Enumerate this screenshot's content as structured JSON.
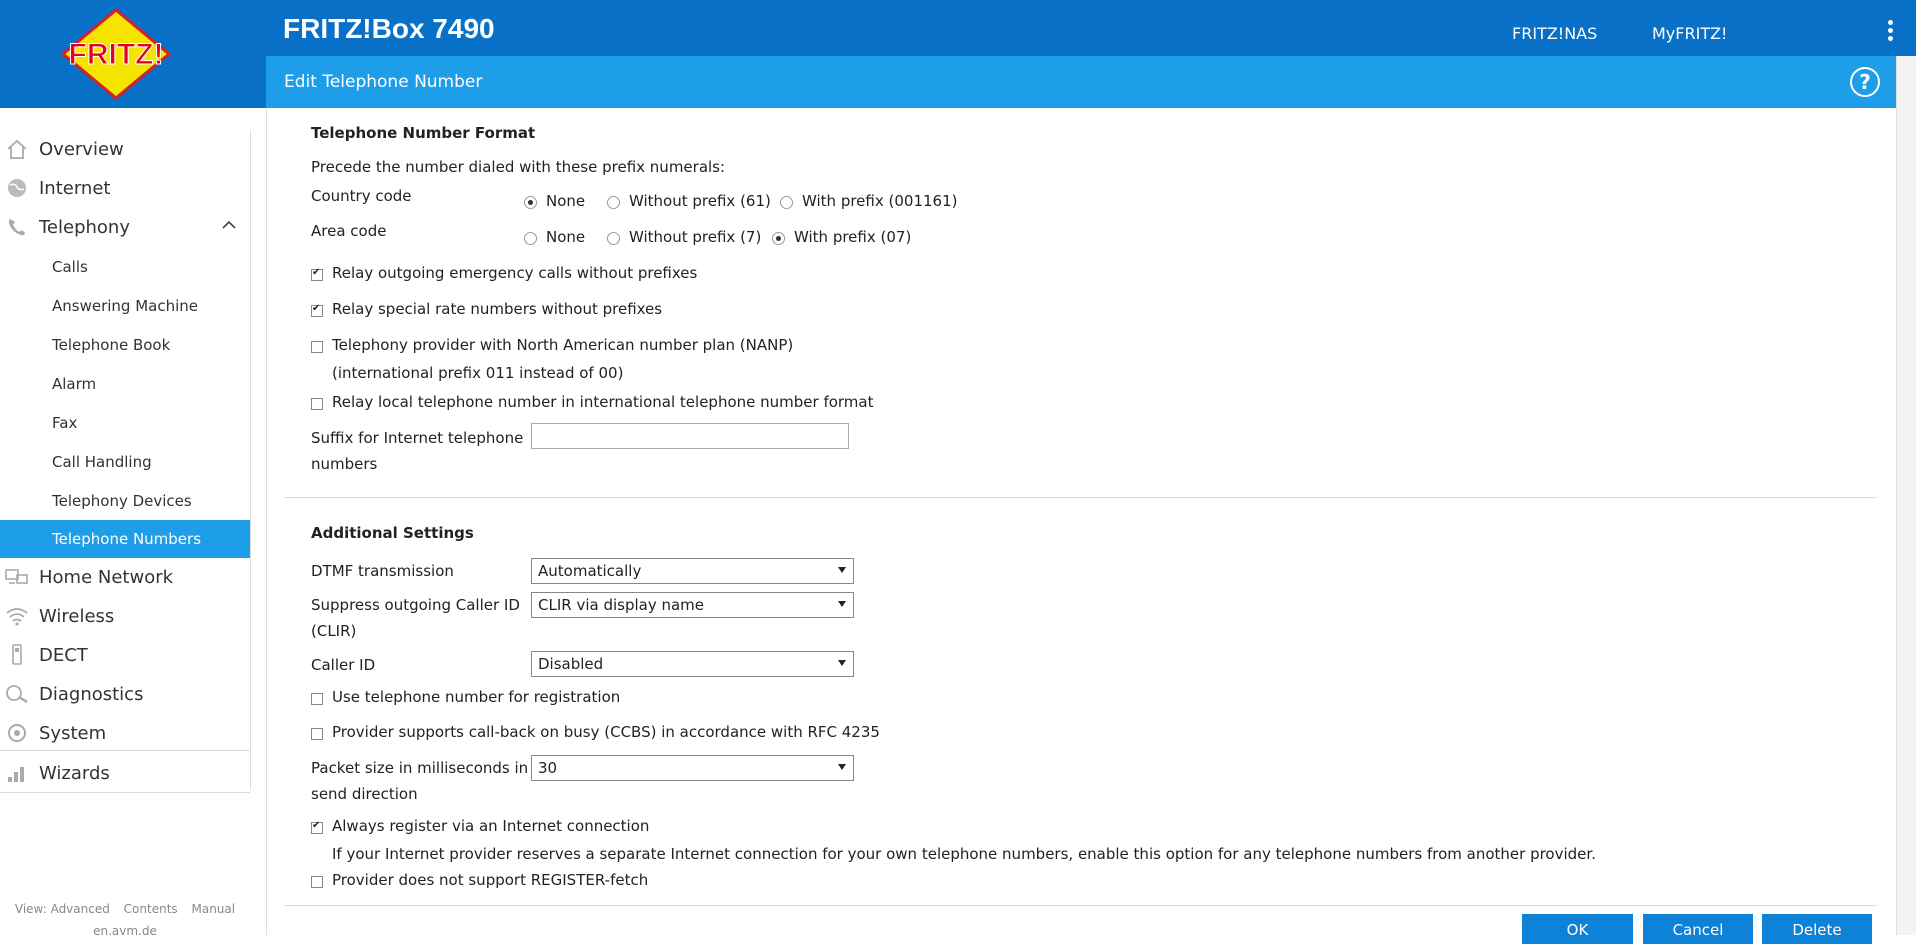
{
  "header": {
    "logo_text": "FRITZ!",
    "product_title": "FRITZ!Box 7490",
    "links": [
      "FRITZ!NAS",
      "MyFRITZ!"
    ],
    "page_title": "Edit Telephone Number",
    "help_label": "?"
  },
  "sidebar": {
    "items": [
      {
        "label": "Overview",
        "icon": "home-icon"
      },
      {
        "label": "Internet",
        "icon": "globe-icon"
      },
      {
        "label": "Telephony",
        "icon": "phone-icon",
        "expanded": true
      },
      {
        "label": "Home Network",
        "icon": "network-icon"
      },
      {
        "label": "Wireless",
        "icon": "wifi-icon"
      },
      {
        "label": "DECT",
        "icon": "dect-icon"
      },
      {
        "label": "Diagnostics",
        "icon": "diagnostics-icon"
      },
      {
        "label": "System",
        "icon": "system-icon"
      },
      {
        "label": "Wizards",
        "icon": "wizard-icon"
      }
    ],
    "telephony_sub": [
      "Calls",
      "Answering Machine",
      "Telephone Book",
      "Alarm",
      "Fax",
      "Call Handling",
      "Telephony Devices",
      "Telephone Numbers"
    ],
    "active_sub": "Telephone Numbers",
    "footer_links": [
      "View: Advanced",
      "Contents",
      "Manual"
    ],
    "footer_site": "en.avm.de"
  },
  "format": {
    "title": "Telephone Number Format",
    "intro": "Precede the number dialed with these prefix numerals:",
    "country_label": "Country code",
    "country_options": [
      "None",
      "Without prefix (61)",
      "With prefix (001161)"
    ],
    "country_selected": "None",
    "area_label": "Area code",
    "area_options": [
      "None",
      "Without prefix (7)",
      "With prefix (07)"
    ],
    "area_selected": "With prefix (07)",
    "emergency": "Relay outgoing emergency calls without prefixes",
    "special": "Relay special rate numbers without prefixes",
    "nanp": "Telephony provider with North American number plan (NANP)",
    "nanp_note": "(international prefix 011 instead of 00)",
    "local_intl": "Relay local telephone number in international telephone number format",
    "suffix_label_1": "Suffix for Internet telephone",
    "suffix_label_2": "numbers",
    "suffix_value": ""
  },
  "additional": {
    "title": "Additional Settings",
    "dtmf_label": "DTMF transmission",
    "dtmf_value": "Automatically",
    "clir_label_1": "Suppress outgoing Caller ID",
    "clir_label_2": "(CLIR)",
    "clir_value": "CLIR via display name",
    "callerid_label": "Caller ID",
    "callerid_value": "Disabled",
    "use_reg": "Use telephone number for registration",
    "ccbs": "Provider supports call-back on busy (CCBS) in accordance with RFC 4235",
    "packet_label_1": "Packet size in milliseconds in",
    "packet_label_2": "send direction",
    "packet_value": "30",
    "always_register": "Always register via an Internet connection",
    "always_note": "If your Internet provider reserves a separate Internet connection for your own telephone numbers, enable this option for any telephone numbers from another provider.",
    "no_fetch": "Provider does not support REGISTER-fetch"
  },
  "buttons": {
    "ok": "OK",
    "cancel": "Cancel",
    "delete": "Delete"
  },
  "colors": {
    "header": "#0870c6",
    "subbar": "#1e9de8",
    "active": "#1e9de8",
    "button": "#0d82d6"
  }
}
